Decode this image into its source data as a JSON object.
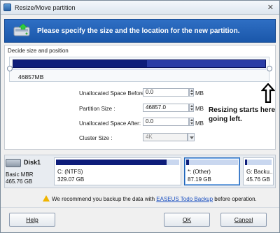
{
  "window": {
    "title": "Resize/Move partition",
    "close_glyph": "✕"
  },
  "banner": {
    "text": "Please specify the size and the location for the new partition."
  },
  "group": {
    "legend": "Decide size and position"
  },
  "sizer": {
    "size_label": "46857MB",
    "used_fraction": 0.53
  },
  "fields": {
    "unalloc_before": {
      "label": "Unallocated Space Before:",
      "value": "0.0",
      "unit": "MB"
    },
    "partition_size": {
      "label": "Partition Size :",
      "value": "46857.0",
      "unit": "MB"
    },
    "unalloc_after": {
      "label": "Unallocated Space After:",
      "value": "0.0",
      "unit": "MB"
    },
    "cluster_size": {
      "label": "Cluster Size :",
      "value": "4K"
    }
  },
  "annotation": {
    "text": "Resizing starts here going left."
  },
  "disk": {
    "name": "Disk1",
    "type": "Basic MBR",
    "size": "465.76 GB",
    "partitions": [
      {
        "label": "C: (NTFS)",
        "size": "329.07 GB",
        "fill": 0.9
      },
      {
        "label": "*: (Other)",
        "size": "87.19 GB",
        "fill": 0.05
      },
      {
        "label": "G: Backu..",
        "size": "45.76 GB",
        "fill": 0.08
      }
    ]
  },
  "warning": {
    "prefix": "We recommend you backup the data with ",
    "link": "EASEUS Todo Backup",
    "suffix": " before operation."
  },
  "buttons": {
    "help": "Help",
    "ok": "OK",
    "cancel": "Cancel"
  },
  "colors": {
    "banner": "#1a57aa",
    "partition_used": "#0e1d7a",
    "link": "#1a4fc0",
    "warning_icon": "#f0b400"
  },
  "icons": {
    "app": "app-icon",
    "banner": "disk-partition-icon",
    "disk": "hard-disk-icon",
    "warning": "warning-icon",
    "arrow": "arrow-up-icon"
  }
}
